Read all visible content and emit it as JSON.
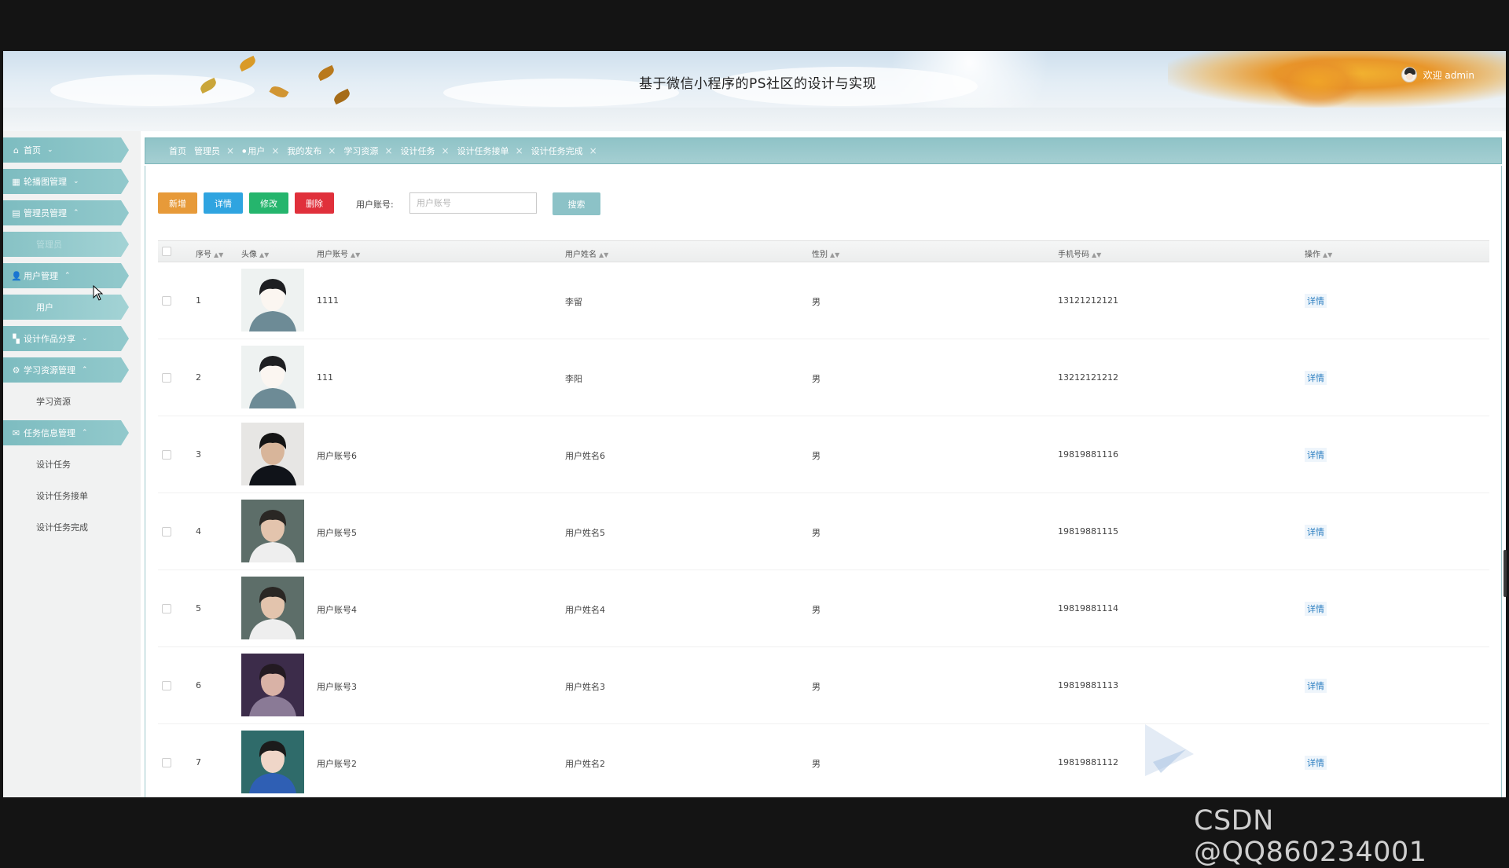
{
  "header": {
    "title": "基于微信小程序的PS社区的设计与实现",
    "welcome": "欢迎 admin"
  },
  "sidebar": {
    "items": [
      {
        "type": "menu",
        "label": "首页",
        "icon": "home-icon",
        "glyph": "⌂",
        "chev": "⌄"
      },
      {
        "type": "menu",
        "label": "轮播图管理",
        "icon": "carousel-icon",
        "glyph": "▦",
        "chev": "⌄"
      },
      {
        "type": "menu",
        "label": "管理员管理",
        "icon": "admin-icon",
        "glyph": "▤",
        "chev": "⌃"
      },
      {
        "type": "sub",
        "label": "管理员",
        "state": "faded"
      },
      {
        "type": "menu",
        "label": "用户管理",
        "icon": "user-icon",
        "glyph": "👤",
        "chev": "⌃"
      },
      {
        "type": "sub",
        "label": "用户",
        "state": "active"
      },
      {
        "type": "menu",
        "label": "设计作品分享",
        "icon": "grid-icon",
        "glyph": "▚",
        "chev": "⌄"
      },
      {
        "type": "menu",
        "label": "学习资源管理",
        "icon": "settings-icon",
        "glyph": "⚙",
        "chev": "⌃"
      },
      {
        "type": "sub",
        "label": "学习资源",
        "state": "normal"
      },
      {
        "type": "menu",
        "label": "任务信息管理",
        "icon": "task-icon",
        "glyph": "✉",
        "chev": "⌃"
      },
      {
        "type": "sub",
        "label": "设计任务",
        "state": "normal"
      },
      {
        "type": "sub",
        "label": "设计任务接单",
        "state": "normal"
      },
      {
        "type": "sub",
        "label": "设计任务完成",
        "state": "normal"
      }
    ]
  },
  "tabs": [
    {
      "label": "首页",
      "closable": false,
      "active": false
    },
    {
      "label": "管理员",
      "closable": true,
      "active": false
    },
    {
      "label": "用户",
      "closable": true,
      "active": true
    },
    {
      "label": "我的发布",
      "closable": true,
      "active": false
    },
    {
      "label": "学习资源",
      "closable": true,
      "active": false
    },
    {
      "label": "设计任务",
      "closable": true,
      "active": false
    },
    {
      "label": "设计任务接单",
      "closable": true,
      "active": false
    },
    {
      "label": "设计任务完成",
      "closable": true,
      "active": false
    }
  ],
  "toolbar": {
    "add_label": "新增",
    "detail_label": "详情",
    "edit_label": "修改",
    "delete_label": "删除",
    "search_label": "用户账号:",
    "search_placeholder": "用户账号",
    "search_button": "搜索"
  },
  "table": {
    "columns": [
      "序号",
      "头像",
      "用户账号",
      "用户姓名",
      "性别",
      "手机号码",
      "操作"
    ],
    "rows": [
      {
        "index": "1",
        "account": "1111",
        "name": "李留",
        "gender": "男",
        "phone": "13121212121",
        "action": "详情",
        "avatar": "anime"
      },
      {
        "index": "2",
        "account": "111",
        "name": "李阳",
        "gender": "男",
        "phone": "13212121212",
        "action": "详情",
        "avatar": "anime"
      },
      {
        "index": "3",
        "account": "用户账号6",
        "name": "用户姓名6",
        "gender": "男",
        "phone": "19819881116",
        "action": "详情",
        "avatar": "dark"
      },
      {
        "index": "4",
        "account": "用户账号5",
        "name": "用户姓名5",
        "gender": "男",
        "phone": "19819881115",
        "action": "详情",
        "avatar": "light"
      },
      {
        "index": "5",
        "account": "用户账号4",
        "name": "用户姓名4",
        "gender": "男",
        "phone": "19819881114",
        "action": "详情",
        "avatar": "light"
      },
      {
        "index": "6",
        "account": "用户账号3",
        "name": "用户姓名3",
        "gender": "男",
        "phone": "19819881113",
        "action": "详情",
        "avatar": "purple"
      },
      {
        "index": "7",
        "account": "用户账号2",
        "name": "用户姓名2",
        "gender": "男",
        "phone": "19819881112",
        "action": "详情",
        "avatar": "blue"
      }
    ]
  },
  "watermark": "CSDN @QQ860234001",
  "colors": {
    "accent": "#8cc2c7",
    "add": "#e79a39",
    "detail": "#2fa4e0",
    "edit": "#25b56d",
    "delete": "#e0303b",
    "link": "#2d7fc1"
  }
}
